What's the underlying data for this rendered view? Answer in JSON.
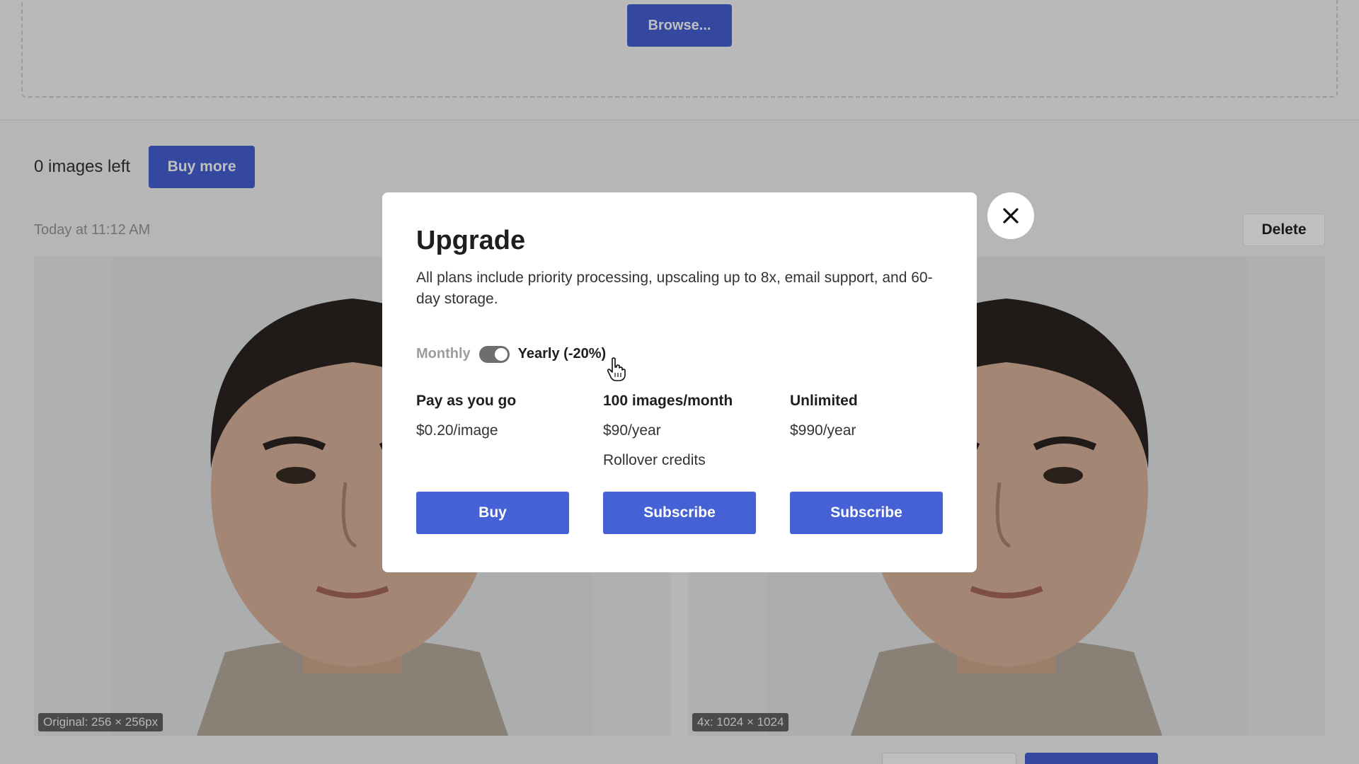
{
  "upload": {
    "browse_label": "Browse..."
  },
  "credits": {
    "text": "0 images left",
    "buy_more_label": "Buy more"
  },
  "result": {
    "timestamp": "Today at 11:12 AM",
    "delete_label": "Delete",
    "original_label": "Original: 256 × 256px",
    "upscaled_label": "4x: 1024 × 1024"
  },
  "modal": {
    "title": "Upgrade",
    "description": "All plans include priority processing, upscaling up to 8x, email support, and 60-day storage.",
    "billing": {
      "monthly_label": "Monthly",
      "yearly_label": "Yearly (-20%)",
      "selected": "Yearly"
    },
    "plans": [
      {
        "name": "Pay as you go",
        "price": "$0.20/image",
        "extra": "",
        "button": "Buy"
      },
      {
        "name": "100 images/month",
        "price": "$90/year",
        "extra": "Rollover credits",
        "button": "Subscribe"
      },
      {
        "name": "Unlimited",
        "price": "$990/year",
        "extra": "",
        "button": "Subscribe"
      }
    ]
  },
  "colors": {
    "accent": "#4661d6",
    "overlay": "rgba(0,0,0,0.25)"
  },
  "icons": {
    "close": "close-icon",
    "cursor": "hand-pointer-cursor"
  }
}
